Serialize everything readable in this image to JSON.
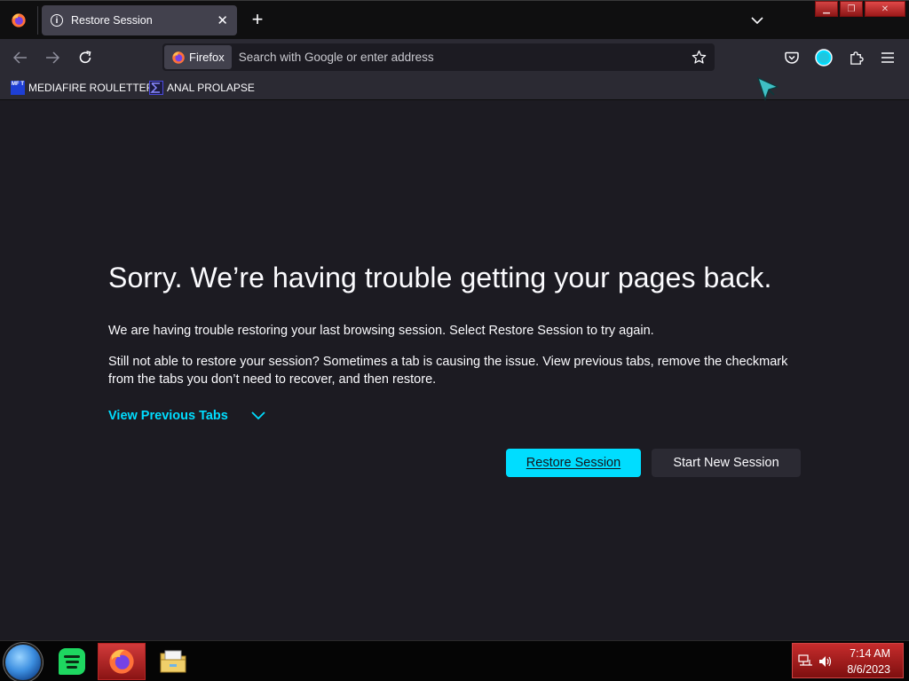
{
  "browser": {
    "tab": {
      "title": "Restore Session",
      "icon": "info-icon",
      "close": "✕"
    },
    "new_tab": "+",
    "window_controls": {
      "minimize": "▁",
      "maximize": "❐",
      "close": "✕"
    }
  },
  "toolbar": {
    "identity_label": "Firefox",
    "url_placeholder": "Search with Google or enter address"
  },
  "bookmarks": [
    {
      "label": "MEDIAFIRE ROULETTER",
      "icon_text": "MF T"
    },
    {
      "label": "ANAL PROLAPSE",
      "icon": "sigma-icon"
    }
  ],
  "page": {
    "heading": "Sorry. We’re having trouble getting your pages back.",
    "para1": "We are having trouble restoring your last browsing session. Select Restore Session to try again.",
    "para2": "Still not able to restore your session? Sometimes a tab is causing the issue. View previous tabs, remove the checkmark from the tabs you don’t need to recover, and then restore.",
    "view_previous": "View Previous Tabs",
    "restore_button": "Restore Session",
    "new_session_button": "Start New Session"
  },
  "taskbar": {
    "time": "7:14 AM",
    "date": "8/6/2023"
  },
  "colors": {
    "accent": "#00ddff",
    "background": "#1c1b22",
    "toolbar": "#2b2a33"
  }
}
